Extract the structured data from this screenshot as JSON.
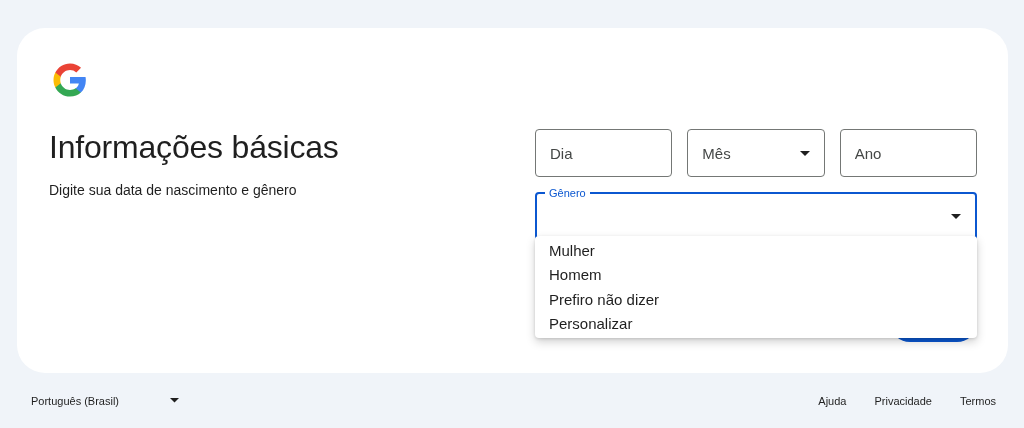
{
  "title": "Informações básicas",
  "subtitle": "Digite sua data de nascimento e gênero",
  "birth_date": [
    {
      "kind": "input",
      "placeholder": "Dia"
    },
    {
      "kind": "select",
      "placeholder": "Mês"
    },
    {
      "kind": "input",
      "placeholder": "Ano"
    }
  ],
  "gender": {
    "label": "Gênero",
    "expanded": true,
    "options": [
      "Mulher",
      "Homem",
      "Prefiro não dizer",
      "Personalizar"
    ]
  },
  "footer": {
    "language": "Português (Brasil)",
    "links": [
      "Ajuda",
      "Privacidade",
      "Termos"
    ]
  }
}
